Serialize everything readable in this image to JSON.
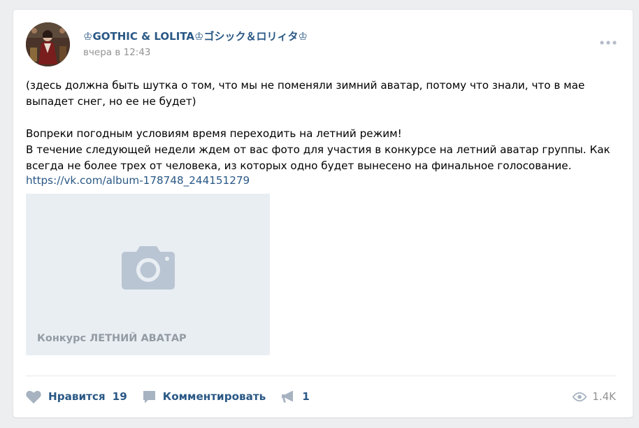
{
  "post": {
    "author": "♔GOTHIC & LOLITA♔ゴシック＆ロリィタ♔",
    "date": "вчера в 12:43",
    "more_icon": "more-horizontal-icon",
    "text": {
      "paragraph1": "(здесь должна быть шутка о том, что мы не поменяли зимний аватар, потому что знали, что в мае выпадет снег, но ее не будет)",
      "paragraph2": "Вопреки погодным условиям время переходить на летний режим!",
      "paragraph3": "В течение следующей недели ждем от вас фото для участия в конкурсе на летний аватар группы. Как всегда не более трех от человека, из которых одно будет вынесено на финальное голосование."
    },
    "link": "https://vk.com/album-178748_244151279",
    "album": {
      "title": "Конкурс ЛЕТНИЙ АВАТАР",
      "icon": "camera-icon"
    }
  },
  "actions": {
    "like": {
      "label": "Нравится",
      "count": "19",
      "icon": "heart-icon"
    },
    "comment": {
      "label": "Комментировать",
      "icon": "comment-icon"
    },
    "share": {
      "count": "1",
      "icon": "megaphone-icon"
    }
  },
  "views": {
    "count": "1.4K",
    "icon": "eye-icon"
  },
  "colors": {
    "link": "#2a5885",
    "muted": "#939393",
    "album_bg": "#e9eef3",
    "icon": "#a8b3c1",
    "page_bg": "#edeef0"
  }
}
